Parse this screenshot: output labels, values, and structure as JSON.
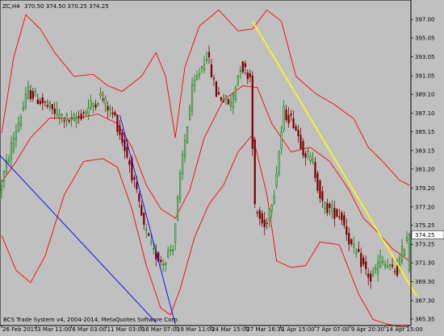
{
  "header": {
    "symbol": "ZC,H4",
    "ohlc": "370.50 374.50 370.25 374.25"
  },
  "footer_note": "BCS Trade System v4, 2004-2014, MetaQuotes Software Corp.",
  "current_price_label": "374.25",
  "colors": {
    "background": "#c0c0c0",
    "bull_candle": "#008000",
    "bear_candle": "#800000",
    "bollinger": "#ff0000",
    "trendline_yellow": "#ffff00",
    "trendline_blue": "#0000ff",
    "grid": "#a8a8a8"
  },
  "chart_data": {
    "type": "candlestick",
    "title": "ZC,H4",
    "y_ticks": [
      "397.00",
      "395.05",
      "393.05",
      "391.05",
      "389.10",
      "387.10",
      "385.15",
      "383.15",
      "381.20",
      "379.20",
      "377.20",
      "375.25",
      "373.25",
      "371.30",
      "369.30",
      "367.30",
      "365.35"
    ],
    "x_ticks": [
      "26 Feb 2015",
      "3 Mar 11:00",
      "6 Mar 03:00",
      "11 Mar 03:00",
      "16 Mar 07:00",
      "19 Mar 11:00",
      "24 Mar 15:00",
      "27 Mar 16:30",
      "1 Apr 15:00",
      "7 Apr 07:00",
      "9 Apr 20:30",
      "14 Apr 15:00"
    ],
    "ylim": [
      365.35,
      397.95
    ],
    "candle_count": 170,
    "last_ohlc": {
      "open": 370.5,
      "high": 374.5,
      "low": 370.25,
      "close": 374.25
    },
    "price_path": [
      {
        "index": 0,
        "price": 378.8
      },
      {
        "index": 6,
        "price": 384.5
      },
      {
        "index": 12,
        "price": 389.4
      },
      {
        "index": 18,
        "price": 388.2
      },
      {
        "index": 24,
        "price": 387.0
      },
      {
        "index": 30,
        "price": 386.2
      },
      {
        "index": 36,
        "price": 387.4
      },
      {
        "index": 42,
        "price": 388.9
      },
      {
        "index": 48,
        "price": 386.6
      },
      {
        "index": 54,
        "price": 381.8
      },
      {
        "index": 60,
        "price": 375.0
      },
      {
        "index": 64,
        "price": 372.3
      },
      {
        "index": 68,
        "price": 371.4
      },
      {
        "index": 72,
        "price": 373.2
      },
      {
        "index": 76,
        "price": 382.5
      },
      {
        "index": 80,
        "price": 389.5
      },
      {
        "index": 86,
        "price": 393.4
      },
      {
        "index": 90,
        "price": 389.2
      },
      {
        "index": 96,
        "price": 388.0
      },
      {
        "index": 100,
        "price": 392.2
      },
      {
        "index": 104,
        "price": 391.0
      },
      {
        "index": 106,
        "price": 377.0
      },
      {
        "index": 110,
        "price": 375.0
      },
      {
        "index": 114,
        "price": 379.0
      },
      {
        "index": 118,
        "price": 387.2
      },
      {
        "index": 122,
        "price": 386.2
      },
      {
        "index": 126,
        "price": 383.3
      },
      {
        "index": 130,
        "price": 381.8
      },
      {
        "index": 134,
        "price": 377.4
      },
      {
        "index": 138,
        "price": 376.8
      },
      {
        "index": 142,
        "price": 376.2
      },
      {
        "index": 146,
        "price": 373.0
      },
      {
        "index": 150,
        "price": 371.4
      },
      {
        "index": 154,
        "price": 369.5
      },
      {
        "index": 158,
        "price": 371.6
      },
      {
        "index": 162,
        "price": 370.6
      },
      {
        "index": 165,
        "price": 370.5
      },
      {
        "index": 169,
        "price": 374.25
      }
    ],
    "bollinger_bands": {
      "upper": [
        {
          "index": 0,
          "price": 385.0
        },
        {
          "index": 5,
          "price": 393.0
        },
        {
          "index": 10,
          "price": 397.5
        },
        {
          "index": 16,
          "price": 396.0
        },
        {
          "index": 22,
          "price": 393.5
        },
        {
          "index": 30,
          "price": 391.0
        },
        {
          "index": 38,
          "price": 391.2
        },
        {
          "index": 44,
          "price": 390.0
        },
        {
          "index": 50,
          "price": 389.4
        },
        {
          "index": 58,
          "price": 391.0
        },
        {
          "index": 64,
          "price": 393.5
        },
        {
          "index": 68,
          "price": 391.0
        },
        {
          "index": 72,
          "price": 384.5
        },
        {
          "index": 76,
          "price": 392.0
        },
        {
          "index": 82,
          "price": 396.3
        },
        {
          "index": 90,
          "price": 398.0
        },
        {
          "index": 98,
          "price": 395.8
        },
        {
          "index": 104,
          "price": 396.0
        },
        {
          "index": 110,
          "price": 398.0
        },
        {
          "index": 116,
          "price": 396.8
        },
        {
          "index": 122,
          "price": 391.0
        },
        {
          "index": 130,
          "price": 389.2
        },
        {
          "index": 138,
          "price": 388.0
        },
        {
          "index": 146,
          "price": 386.5
        },
        {
          "index": 152,
          "price": 383.5
        },
        {
          "index": 158,
          "price": 382.0
        },
        {
          "index": 165,
          "price": 380.0
        },
        {
          "index": 169,
          "price": 379.5
        }
      ],
      "middle": [
        {
          "index": 0,
          "price": 379.8
        },
        {
          "index": 6,
          "price": 382.0
        },
        {
          "index": 12,
          "price": 384.5
        },
        {
          "index": 20,
          "price": 386.6
        },
        {
          "index": 30,
          "price": 386.5
        },
        {
          "index": 40,
          "price": 387.0
        },
        {
          "index": 48,
          "price": 386.0
        },
        {
          "index": 54,
          "price": 383.5
        },
        {
          "index": 60,
          "price": 379.5
        },
        {
          "index": 66,
          "price": 377.0
        },
        {
          "index": 72,
          "price": 376.0
        },
        {
          "index": 78,
          "price": 379.0
        },
        {
          "index": 84,
          "price": 384.5
        },
        {
          "index": 92,
          "price": 388.5
        },
        {
          "index": 100,
          "price": 390.0
        },
        {
          "index": 106,
          "price": 389.8
        },
        {
          "index": 112,
          "price": 386.0
        },
        {
          "index": 120,
          "price": 383.0
        },
        {
          "index": 128,
          "price": 383.5
        },
        {
          "index": 136,
          "price": 382.0
        },
        {
          "index": 144,
          "price": 379.0
        },
        {
          "index": 150,
          "price": 376.0
        },
        {
          "index": 156,
          "price": 374.5
        },
        {
          "index": 162,
          "price": 372.8
        },
        {
          "index": 169,
          "price": 371.5
        }
      ],
      "lower": [
        {
          "index": 0,
          "price": 374.2
        },
        {
          "index": 6,
          "price": 370.5
        },
        {
          "index": 12,
          "price": 369.2
        },
        {
          "index": 18,
          "price": 372.0
        },
        {
          "index": 26,
          "price": 378.5
        },
        {
          "index": 34,
          "price": 382.0
        },
        {
          "index": 42,
          "price": 382.3
        },
        {
          "index": 48,
          "price": 381.4
        },
        {
          "index": 54,
          "price": 377.0
        },
        {
          "index": 60,
          "price": 371.0
        },
        {
          "index": 66,
          "price": 366.5
        },
        {
          "index": 70,
          "price": 365.8
        },
        {
          "index": 74,
          "price": 368.5
        },
        {
          "index": 80,
          "price": 374.0
        },
        {
          "index": 86,
          "price": 377.5
        },
        {
          "index": 92,
          "price": 379.5
        },
        {
          "index": 98,
          "price": 383.0
        },
        {
          "index": 104,
          "price": 384.8
        },
        {
          "index": 110,
          "price": 378.5
        },
        {
          "index": 114,
          "price": 371.5
        },
        {
          "index": 120,
          "price": 370.8
        },
        {
          "index": 126,
          "price": 371.0
        },
        {
          "index": 132,
          "price": 373.5
        },
        {
          "index": 140,
          "price": 373.2
        },
        {
          "index": 148,
          "price": 368.0
        },
        {
          "index": 154,
          "price": 365.3
        },
        {
          "index": 160,
          "price": 364.8
        },
        {
          "index": 166,
          "price": 364.5
        },
        {
          "index": 169,
          "price": 364.6
        }
      ]
    },
    "trendlines": [
      {
        "name": "yellow",
        "from": {
          "index": 104,
          "price": 396.8
        },
        "to": {
          "index": 172,
          "price": 367.8
        }
      },
      {
        "name": "blue-1",
        "from": {
          "index": -2,
          "price": 383.0
        },
        "to": {
          "index": 64,
          "price": 365.0
        }
      },
      {
        "name": "blue-2",
        "from": {
          "index": 49,
          "price": 386.9
        },
        "to": {
          "index": 72,
          "price": 364.8
        }
      }
    ],
    "grid": false,
    "legend": "none"
  }
}
